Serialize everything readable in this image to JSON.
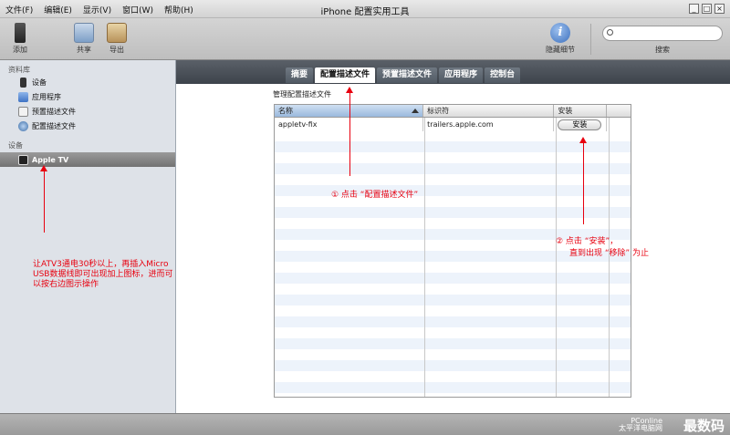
{
  "menu": [
    "文件(F)",
    "编辑(E)",
    "显示(V)",
    "窗口(W)",
    "帮助(H)"
  ],
  "window_title": "iPhone 配置实用工具",
  "window_controls": [
    "_",
    "□",
    "×"
  ],
  "toolbar": {
    "add": "添加",
    "share": "共享",
    "export": "导出",
    "hide_details": "隐藏细节",
    "search_label": "搜索",
    "search_value": ""
  },
  "sidebar": {
    "library_header": "资料库",
    "library_items": [
      "设备",
      "应用程序",
      "预置描述文件",
      "配置描述文件"
    ],
    "devices_header": "设备",
    "device_selected": "Apple TV"
  },
  "tabs": [
    "摘要",
    "配置描述文件",
    "预置描述文件",
    "应用程序",
    "控制台"
  ],
  "active_tab": "配置描述文件",
  "section_title": "管理配置描述文件",
  "table": {
    "columns": [
      "名称",
      "标识符",
      "安装"
    ],
    "rows": [
      {
        "name": "appletv-fix",
        "identifier": "trailers.apple.com",
        "action": "安装"
      }
    ]
  },
  "annotations": {
    "step1": "① 点击 “配置描述文件”",
    "step2_line1": "② 点击 “安装”，",
    "step2_line2": "直到出现 “移除” 为止",
    "left_note": "让ATV3通电30秒以上，再插入Micro USB数据线即可出现加上图标，进而可以按右边图示操作"
  },
  "watermark": {
    "brand": "PConline",
    "sub": "太平洋电脑网",
    "title": "最数码"
  }
}
